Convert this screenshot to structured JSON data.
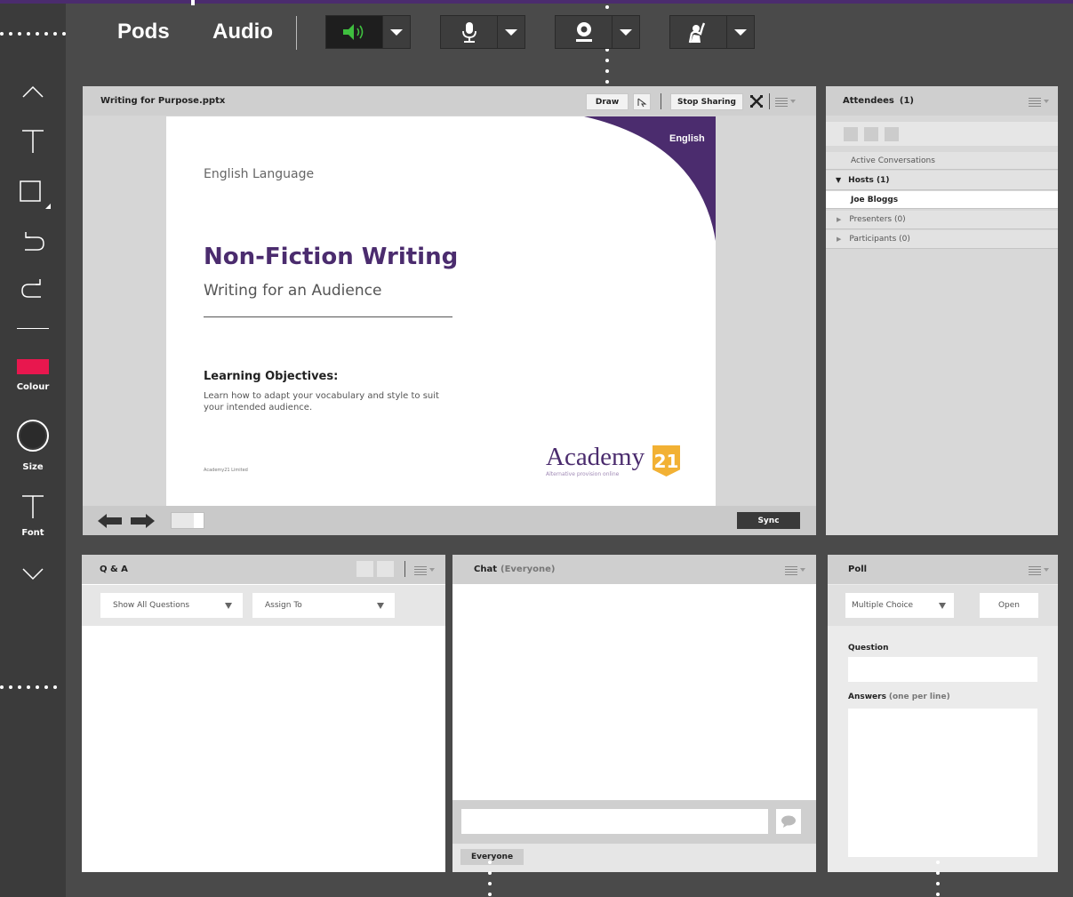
{
  "toolbar": {
    "pods_label": "Pods",
    "audio_label": "Audio",
    "speaker_icon": "speaker-icon",
    "mic_icon": "microphone-icon",
    "webcam_icon": "webcam-icon",
    "raise_hand_icon": "raise-hand-icon",
    "accent": "#4b2c6e",
    "speaker_active_color": "#3fbf3f"
  },
  "sidebar": {
    "colour_label": "Colour",
    "size_label": "Size",
    "font_label": "Font",
    "colour_value": "#e8174e"
  },
  "share_pod": {
    "title": "Writing for Purpose.pptx",
    "draw_label": "Draw",
    "stop_sharing_label": "Stop Sharing",
    "sync_label": "Sync",
    "slide": {
      "ribbon_label": "English",
      "eyebrow": "English Language",
      "title": "Non-Fiction Writing",
      "subtitle": "Writing for an Audience",
      "objectives_heading": "Learning Objectives:",
      "objectives_text": "Learn how to adapt your vocabulary and style to suit your intended audience.",
      "footer_left": "Academy21 Limited",
      "logo_word": "Academy",
      "logo_badge": "21",
      "logo_tagline": "Alternative provision online",
      "accent": "#4b2c6e",
      "badge_color": "#f2b134"
    }
  },
  "attendees_pod": {
    "title": "Attendees",
    "count": "(1)",
    "active_conversations": "Active Conversations",
    "hosts_label": "Hosts (1)",
    "host_name": "Joe Bloggs",
    "presenters_label": "Presenters (0)",
    "participants_label": "Participants (0)"
  },
  "qa_pod": {
    "title": "Q & A",
    "filter_value": "Show All Questions",
    "assign_value": "Assign To"
  },
  "chat_pod": {
    "title": "Chat",
    "scope": "(Everyone)",
    "recipient_tab": "Everyone",
    "message_value": ""
  },
  "poll_pod": {
    "title": "Poll",
    "type_value": "Multiple Choice",
    "open_label": "Open",
    "question_label": "Question",
    "answers_label": "Answers",
    "answers_hint": "(one per line)",
    "question_value": "",
    "answers_value": ""
  }
}
